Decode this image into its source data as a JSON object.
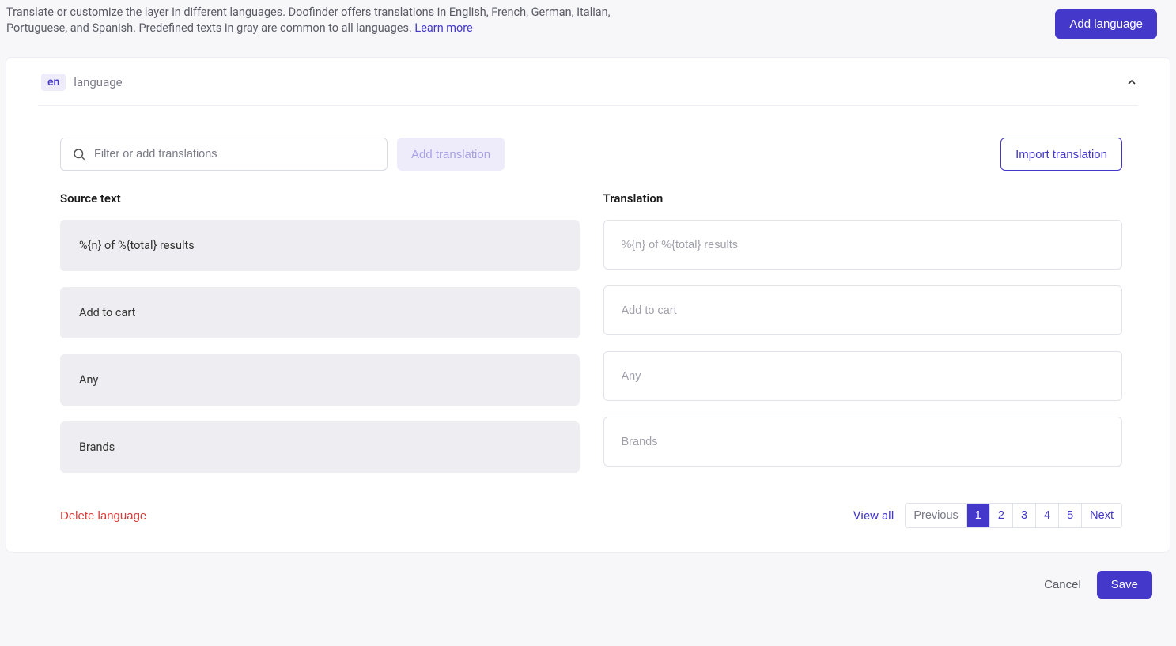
{
  "header": {
    "description_main": "Translate or customize the layer in different languages. Doofinder offers translations in English, French, German, Italian, Portuguese, and Spanish. Predefined texts in gray are common to all languages. ",
    "learn_more": "Learn more",
    "add_language": "Add language"
  },
  "card": {
    "lang_code": "en",
    "lang_label": "language",
    "filter_placeholder": "Filter or add translations",
    "add_translation": "Add translation",
    "import_translation": "Import translation",
    "col_source": "Source text",
    "col_translation": "Translation",
    "rows": [
      {
        "source": "%{n} of %{total} results",
        "placeholder": "%{n} of %{total} results"
      },
      {
        "source": "Add to cart",
        "placeholder": "Add to cart"
      },
      {
        "source": "Any",
        "placeholder": "Any"
      },
      {
        "source": "Brands",
        "placeholder": "Brands"
      }
    ],
    "delete_language": "Delete language",
    "view_all": "View all",
    "pagination": {
      "previous": "Previous",
      "pages": [
        "1",
        "2",
        "3",
        "4",
        "5"
      ],
      "active": "1",
      "next": "Next"
    }
  },
  "footer": {
    "cancel": "Cancel",
    "save": "Save"
  }
}
